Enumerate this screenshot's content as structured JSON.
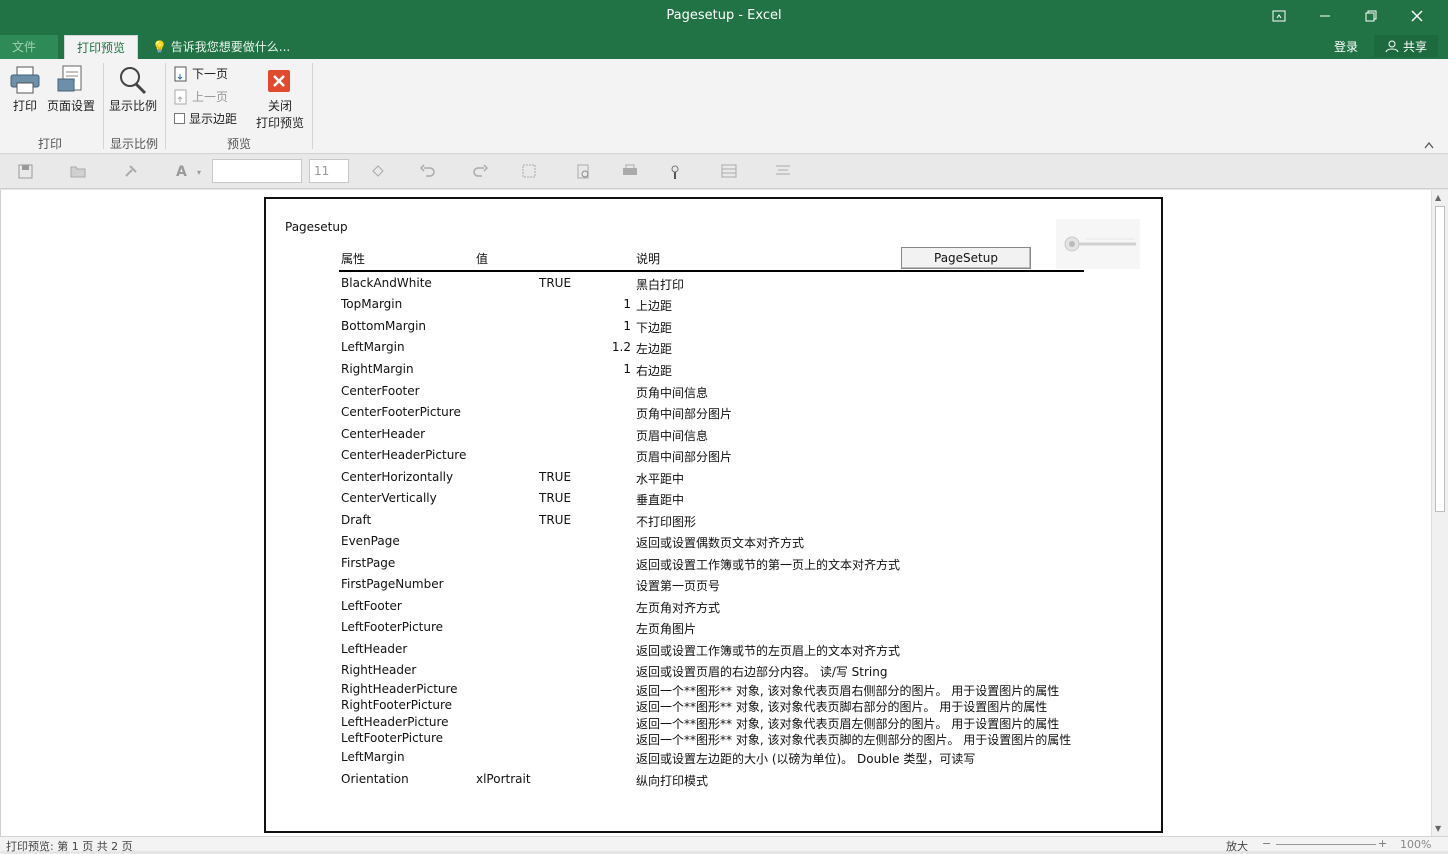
{
  "window": {
    "title": "Pagesetup - Excel"
  },
  "tabs": {
    "file": "文件",
    "print_preview": "打印预览",
    "tell_me": "告诉我您想要做什么...",
    "sign_in": "登录",
    "share": "共享"
  },
  "ribbon": {
    "print": "打印",
    "page_setup": "页面设置",
    "zoom": "显示比例",
    "next_page": "下一页",
    "prev_page": "上一页",
    "show_margins": "显示边距",
    "close_line1": "关闭",
    "close_line2": "打印预览",
    "group_print": "打印",
    "group_zoom": "显示比例",
    "group_preview": "预览"
  },
  "qat": {
    "font_size": "11"
  },
  "sheet": {
    "title": "Pagesetup",
    "headers": {
      "property": "属性",
      "value": "值",
      "description": "说明"
    },
    "button_label": "PageSetup",
    "rows": [
      {
        "name": "BlackAndWhite",
        "value": "TRUE",
        "desc": "黑白打印"
      },
      {
        "name": "TopMargin",
        "num": "1",
        "desc": "上边距"
      },
      {
        "name": "BottomMargin",
        "num": "1",
        "desc": "下边距"
      },
      {
        "name": "LeftMargin",
        "num": "1.2",
        "desc": "左边距"
      },
      {
        "name": "RightMargin",
        "num": "1",
        "desc": "右边距"
      },
      {
        "name": "CenterFooter",
        "desc": "页角中间信息"
      },
      {
        "name": "CenterFooterPicture",
        "desc": "页角中间部分图片"
      },
      {
        "name": "CenterHeader",
        "desc": "页眉中间信息"
      },
      {
        "name": "CenterHeaderPicture",
        "desc": "页眉中间部分图片"
      },
      {
        "name": "CenterHorizontally",
        "value": "TRUE",
        "desc": "水平距中"
      },
      {
        "name": "CenterVertically",
        "value": "TRUE",
        "desc": "垂直距中"
      },
      {
        "name": "Draft",
        "value": "TRUE",
        "desc": "不打印图形"
      },
      {
        "name": "EvenPage",
        "desc": "返回或设置偶数页文本对齐方式"
      },
      {
        "name": "FirstPage",
        "desc": "返回或设置工作簿或节的第一页上的文本对齐方式"
      },
      {
        "name": "FirstPageNumber",
        "desc": "设置第一页页号"
      },
      {
        "name": "LeftFooter",
        "desc": "左页角对齐方式"
      },
      {
        "name": "LeftFooterPicture",
        "desc": "左页角图片"
      },
      {
        "name": "LeftHeader",
        "desc": "返回或设置工作簿或节的左页眉上的文本对齐方式"
      },
      {
        "name": "RightHeader",
        "desc": "返回或设置页眉的右边部分内容。 读/写 String"
      },
      {
        "name": "RightHeaderPicture",
        "desc": "返回一个**图形** 对象, 该对象代表页眉右侧部分的图片。 用于设置图片的属性"
      },
      {
        "name": "RightFooterPicture",
        "desc": "返回一个**图形** 对象, 该对象代表页脚右部分的图片。 用于设置图片的属性"
      },
      {
        "name": "LeftHeaderPicture",
        "desc": "返回一个**图形** 对象, 该对象代表页眉左侧部分的图片。 用于设置图片的属性"
      },
      {
        "name": "LeftFooterPicture",
        "desc": "返回一个**图形** 对象, 该对象代表页脚的左侧部分的图片。 用于设置图片的属性"
      },
      {
        "name": "LeftMargin",
        "desc": "返回或设置左边距的大小 (以磅为单位)。 Double 类型，可读写"
      },
      {
        "name": "Orientation",
        "text_value": "xlPortrait",
        "desc": "纵向打印模式"
      }
    ]
  },
  "status": {
    "left": "打印预览: 第 1 页  共 2 页",
    "zoom_label": "放大",
    "zoom_pct": "100%"
  },
  "colors": {
    "brand": "#217346",
    "close_icon": "#e04a2f"
  }
}
